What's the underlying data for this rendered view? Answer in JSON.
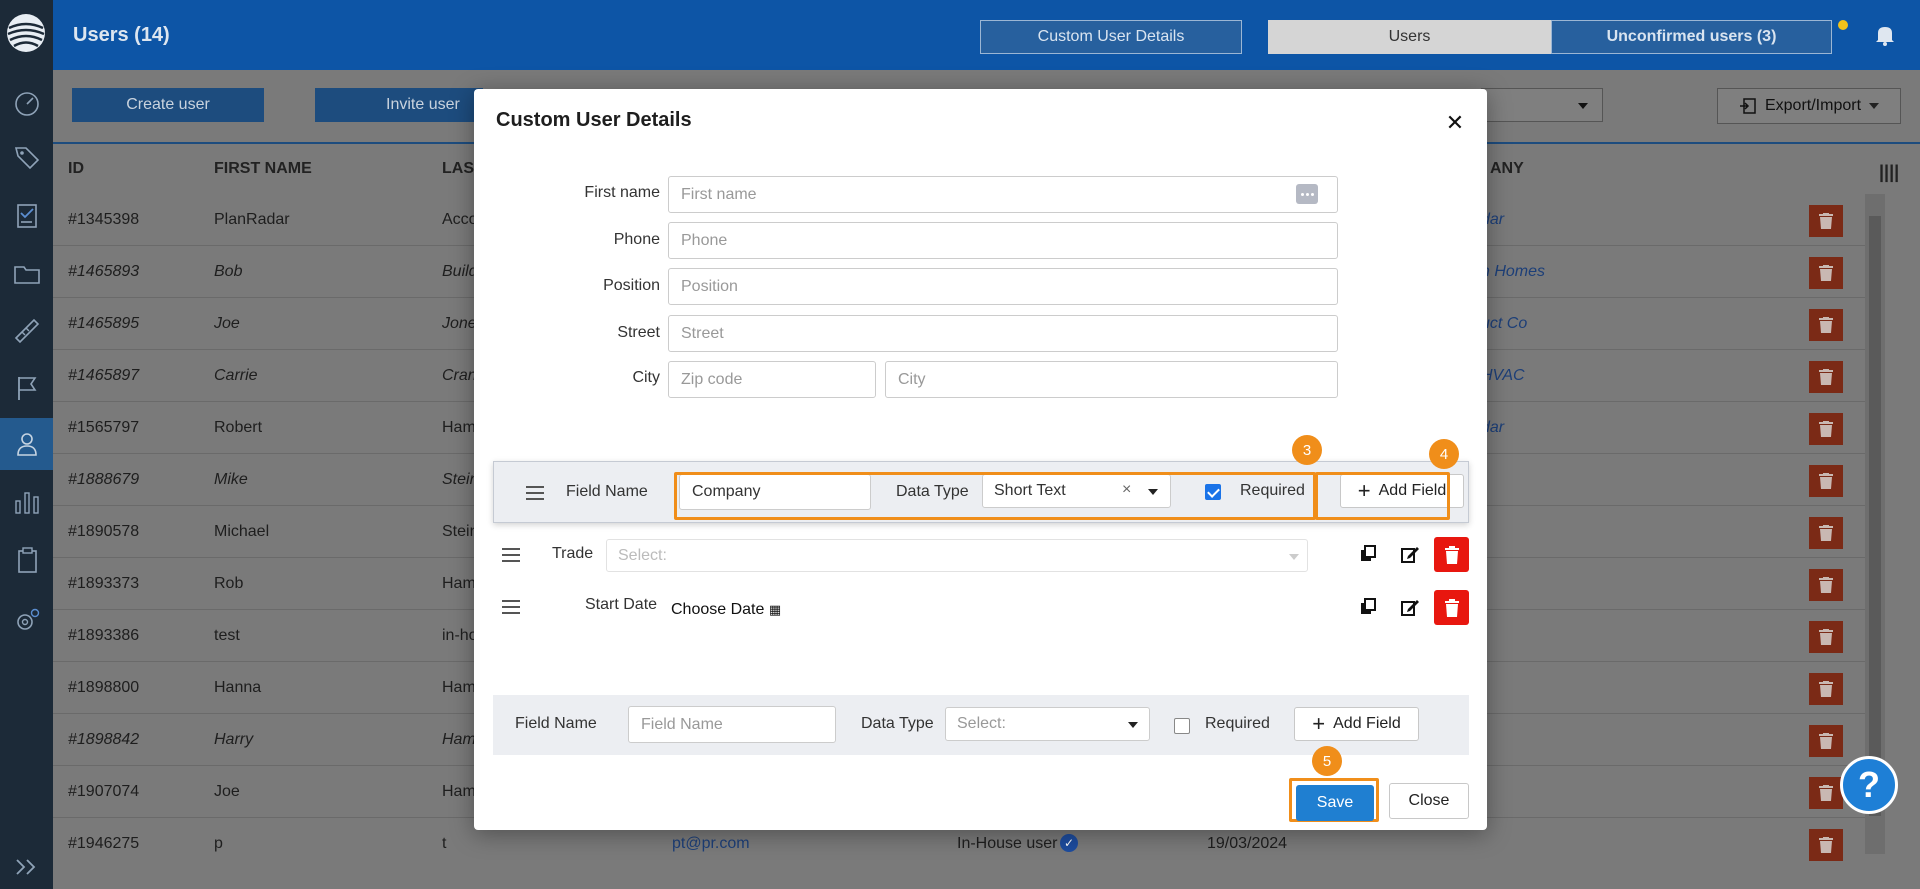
{
  "header": {
    "title": "Users (14)",
    "custom_details_label": "Custom User Details",
    "users_tab": "Users",
    "unconfirmed_tab": "Unconfirmed users (3)"
  },
  "toolbar": {
    "create_user": "Create user",
    "invite_user": "Invite user",
    "export_import": "Export/Import"
  },
  "table": {
    "columns": [
      "ID",
      "FIRST NAME",
      "LAST",
      "ANY"
    ],
    "rows": [
      {
        "id": "#1345398",
        "first": "PlanRadar",
        "last": "Acco",
        "company": "dar",
        "italic": false
      },
      {
        "id": "#1465893",
        "first": "Bob",
        "last": "Build",
        "company": "n Homes",
        "italic": true
      },
      {
        "id": "#1465895",
        "first": "Joe",
        "last": "Jone",
        "company": "uct Co",
        "italic": true
      },
      {
        "id": "#1465897",
        "first": "Carrie",
        "last": "Cran",
        "company": "HVAC",
        "italic": true
      },
      {
        "id": "#1565797",
        "first": "Robert",
        "last": "Ham",
        "company": "dar",
        "italic": false
      },
      {
        "id": "#1888679",
        "first": "Mike",
        "last": "Stein",
        "company": "",
        "italic": true
      },
      {
        "id": "#1890578",
        "first": "Michael",
        "last": "Stein",
        "company": "",
        "italic": false
      },
      {
        "id": "#1893373",
        "first": "Rob",
        "last": "Ham",
        "company": "",
        "italic": false
      },
      {
        "id": "#1893386",
        "first": "test",
        "last": "in-ho",
        "company": "",
        "italic": false
      },
      {
        "id": "#1898800",
        "first": "Hanna",
        "last": "Ham",
        "company": "",
        "italic": false
      },
      {
        "id": "#1898842",
        "first": "Harry",
        "last": "Ham",
        "company": "",
        "italic": true
      },
      {
        "id": "#1907074",
        "first": "Joe",
        "last": "Ham",
        "company": "",
        "italic": false
      },
      {
        "id": "#1946275",
        "first": "p",
        "last": "t",
        "company": "",
        "italic": false
      }
    ],
    "last_row_email": "pt@pr.com",
    "last_row_role": "In-House user",
    "last_row_date": "19/03/2024"
  },
  "modal": {
    "title": "Custom User Details",
    "fields": [
      {
        "label": "First name",
        "placeholder": "First name"
      },
      {
        "label": "Phone",
        "placeholder": "Phone"
      },
      {
        "label": "Position",
        "placeholder": "Position"
      },
      {
        "label": "Street",
        "placeholder": "Street"
      },
      {
        "label": "City",
        "placeholder_zip": "Zip code",
        "placeholder_city": "City"
      }
    ],
    "active_field": {
      "field_name_label": "Field Name",
      "field_name_value": "Company",
      "data_type_label": "Data Type",
      "data_type_value": "Short Text",
      "clear_glyph": "×",
      "required_label": "Required",
      "required_checked": true,
      "add_field_label": "Add Field"
    },
    "custom_fields": [
      {
        "name": "Trade",
        "select_placeholder": "Select:"
      },
      {
        "name": "Start Date",
        "value": "Choose Date"
      }
    ],
    "new_field": {
      "field_name_label": "Field Name",
      "field_name_placeholder": "Field Name",
      "data_type_label": "Data Type",
      "data_type_placeholder": "Select:",
      "required_label": "Required",
      "add_field_label": "Add Field"
    },
    "save_label": "Save",
    "close_label": "Close",
    "badges": [
      "3",
      "4",
      "5"
    ]
  },
  "colors": {
    "topbar": "#0d55a6",
    "sidebar": "#1c2a38",
    "highlight": "#f08e1a",
    "save": "#1f7fd1",
    "delete": "#e8170f"
  },
  "help_glyph": "?"
}
